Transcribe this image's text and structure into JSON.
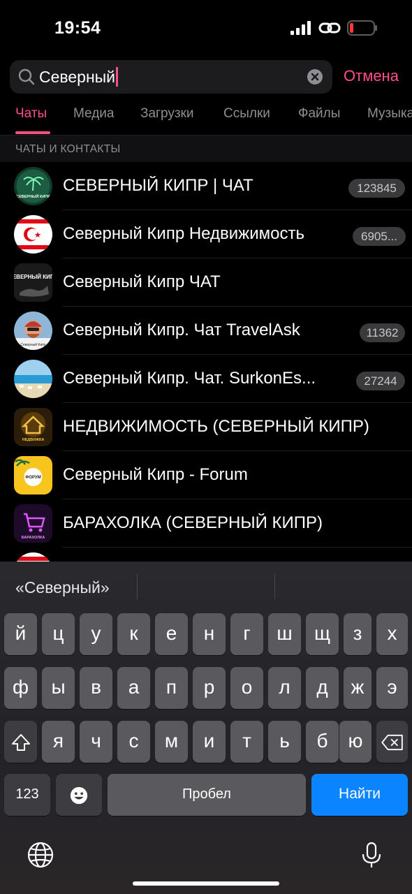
{
  "status": {
    "time": "19:54"
  },
  "search": {
    "query": "Северный",
    "cancel_label": "Отмена"
  },
  "tabs": [
    {
      "label": "Чаты",
      "active": true
    },
    {
      "label": "Медиа"
    },
    {
      "label": "Загрузки"
    },
    {
      "label": "Ссылки"
    },
    {
      "label": "Файлы"
    },
    {
      "label": "Музыка"
    }
  ],
  "section_header": "ЧАТЫ И КОНТАКТЫ",
  "results": [
    {
      "title": "СЕВЕРНЫЙ КИПР | ЧАТ",
      "badge": "123845",
      "avatar_text": "СЕВЕРНЫЙ КИПР"
    },
    {
      "title": "Северный Кипр Недвижимость",
      "badge": "6905..."
    },
    {
      "title": "Северный Кипр ЧАТ",
      "badge": "",
      "avatar_text": "СЕВЕРНЫЙ КИПР"
    },
    {
      "title": "Северный Кипр. Чат TravelAsk",
      "badge": "11362",
      "avatar_text": "Северный Кипр"
    },
    {
      "title": "Северный Кипр. Чат. SurkonEs...",
      "badge": "27244"
    },
    {
      "title": "НЕДВИЖИМОСТЬ (СЕВЕРНЫЙ КИПР)",
      "badge": "",
      "avatar_text": "НЕДВИЖКА"
    },
    {
      "title": "Северный Кипр - Forum",
      "badge": "",
      "avatar_text": "ФОРУМ"
    },
    {
      "title": "БАРАХОЛКА (СЕВЕРНЫЙ КИПР)",
      "badge": "",
      "avatar_text": "БАРАХОЛКА"
    }
  ],
  "keyboard": {
    "suggestion": "«Северный»",
    "row1": [
      "й",
      "ц",
      "у",
      "к",
      "е",
      "н",
      "г",
      "ш",
      "щ",
      "з",
      "х"
    ],
    "row2": [
      "ф",
      "ы",
      "в",
      "а",
      "п",
      "р",
      "о",
      "л",
      "д",
      "ж",
      "э"
    ],
    "row3": [
      "я",
      "ч",
      "с",
      "м",
      "и",
      "т",
      "ь",
      "б",
      "ю"
    ],
    "num_label": "123",
    "space_label": "Пробел",
    "go_label": "Найти"
  }
}
